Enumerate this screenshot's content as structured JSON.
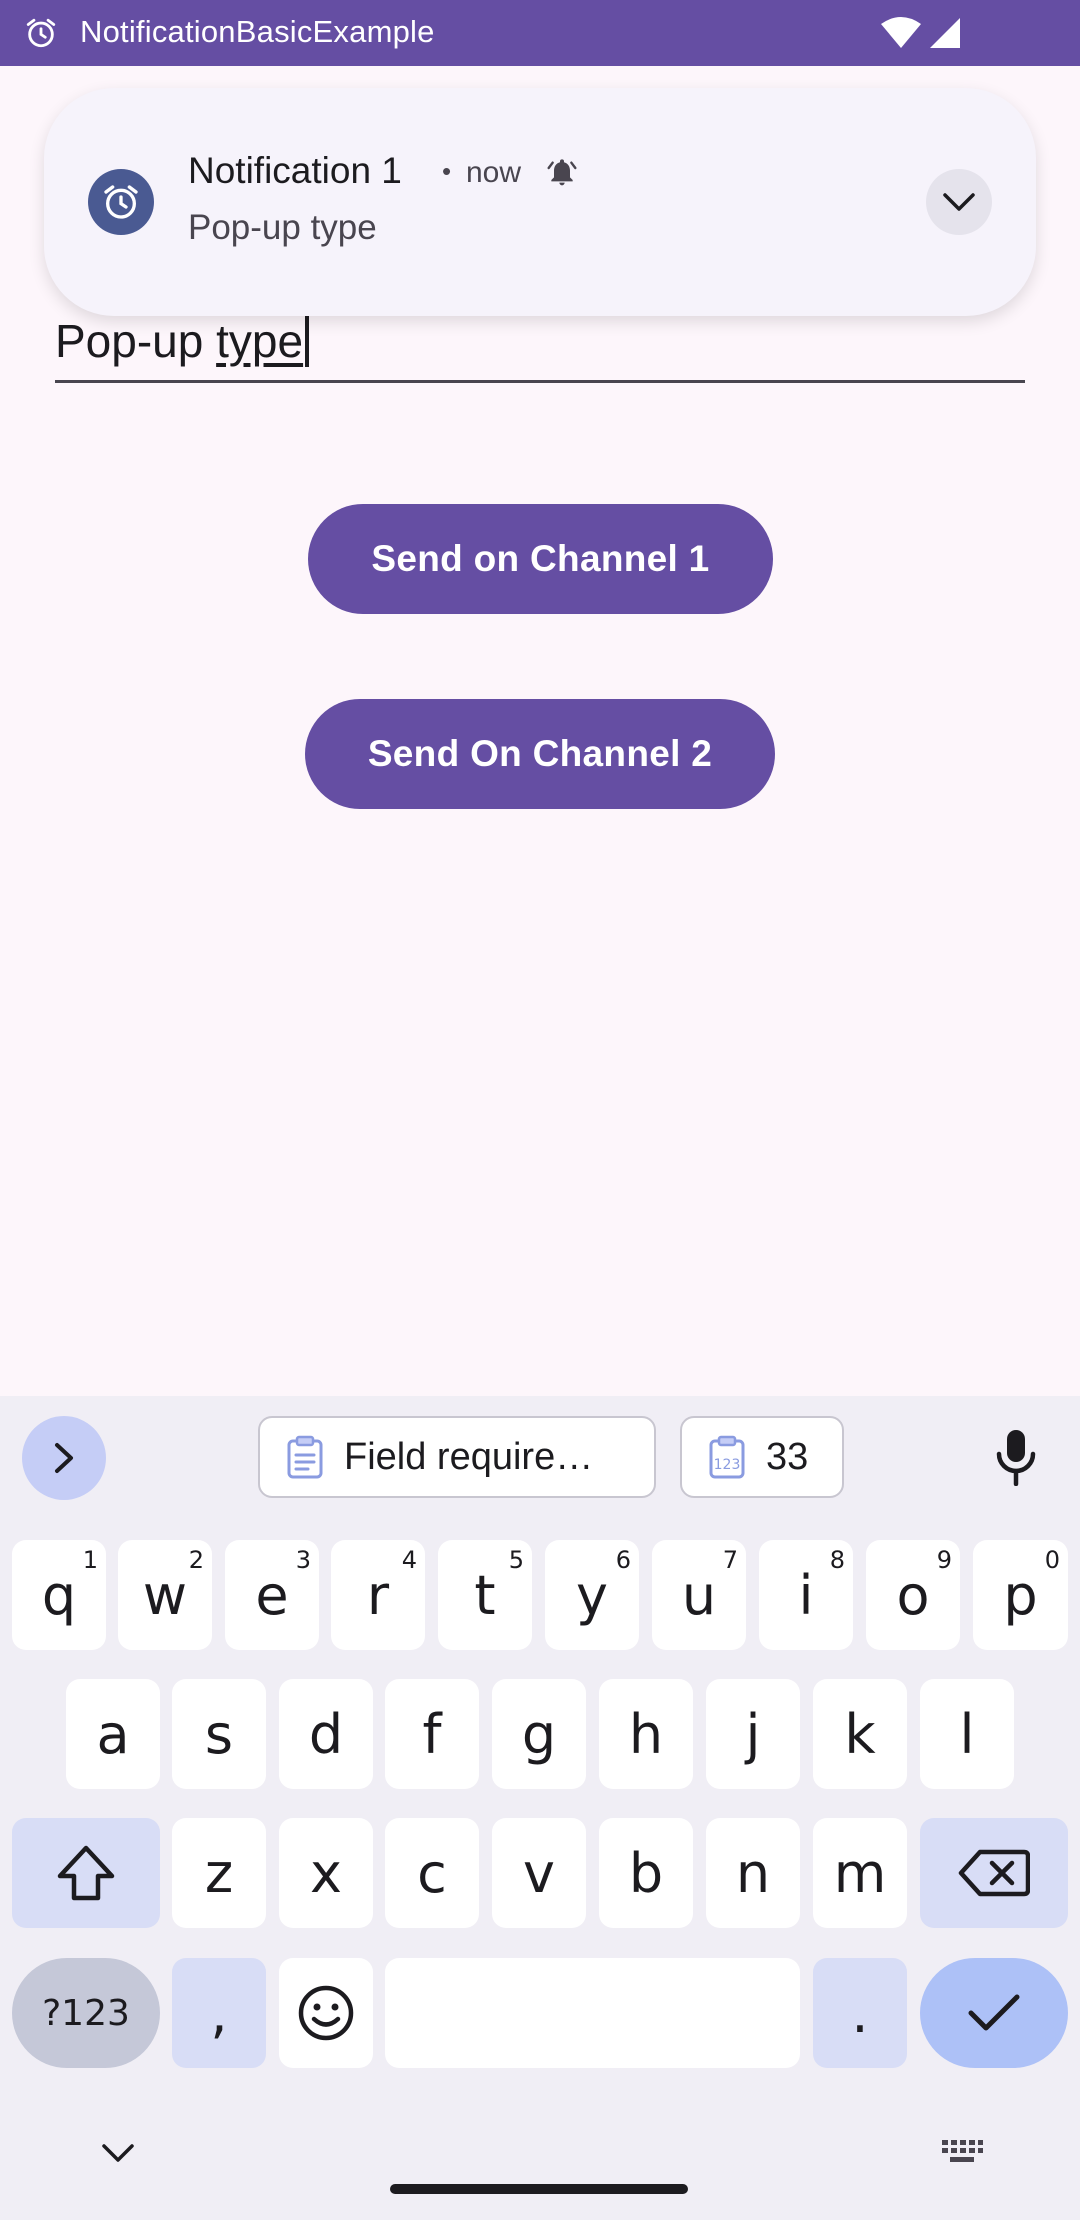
{
  "status_bar": {
    "app_title": "NotificationBasicExample",
    "icons": [
      "alarm-icon",
      "wifi-icon",
      "signal-icon"
    ],
    "background": "#654ea3"
  },
  "notification": {
    "title": "Notification 1",
    "separator": "•",
    "time": "now",
    "text": "Pop-up type",
    "icons": [
      "alarm-icon",
      "bell-icon",
      "chevron-down-icon"
    ]
  },
  "form": {
    "input_value_plain": "Pop-up ",
    "input_value_typed": "type"
  },
  "buttons": {
    "channel1": "Send on Channel 1",
    "channel2": "Send On Channel 2",
    "color": "#654ea3"
  },
  "keyboard": {
    "suggestions": [
      {
        "icon": "clipboard-icon",
        "label": "Field require…"
      },
      {
        "icon": "calendar-number-icon",
        "label": "33"
      }
    ],
    "row1": [
      {
        "key": "q",
        "hint": "1"
      },
      {
        "key": "w",
        "hint": "2"
      },
      {
        "key": "e",
        "hint": "3"
      },
      {
        "key": "r",
        "hint": "4"
      },
      {
        "key": "t",
        "hint": "5"
      },
      {
        "key": "y",
        "hint": "6"
      },
      {
        "key": "u",
        "hint": "7"
      },
      {
        "key": "i",
        "hint": "8"
      },
      {
        "key": "o",
        "hint": "9"
      },
      {
        "key": "p",
        "hint": "0"
      }
    ],
    "row2": [
      "a",
      "s",
      "d",
      "f",
      "g",
      "h",
      "j",
      "k",
      "l"
    ],
    "row3": [
      "z",
      "x",
      "c",
      "v",
      "b",
      "n",
      "m"
    ],
    "row4": {
      "symbols": "?123",
      "comma": ",",
      "period": "."
    },
    "accent": "#adc1f7"
  }
}
